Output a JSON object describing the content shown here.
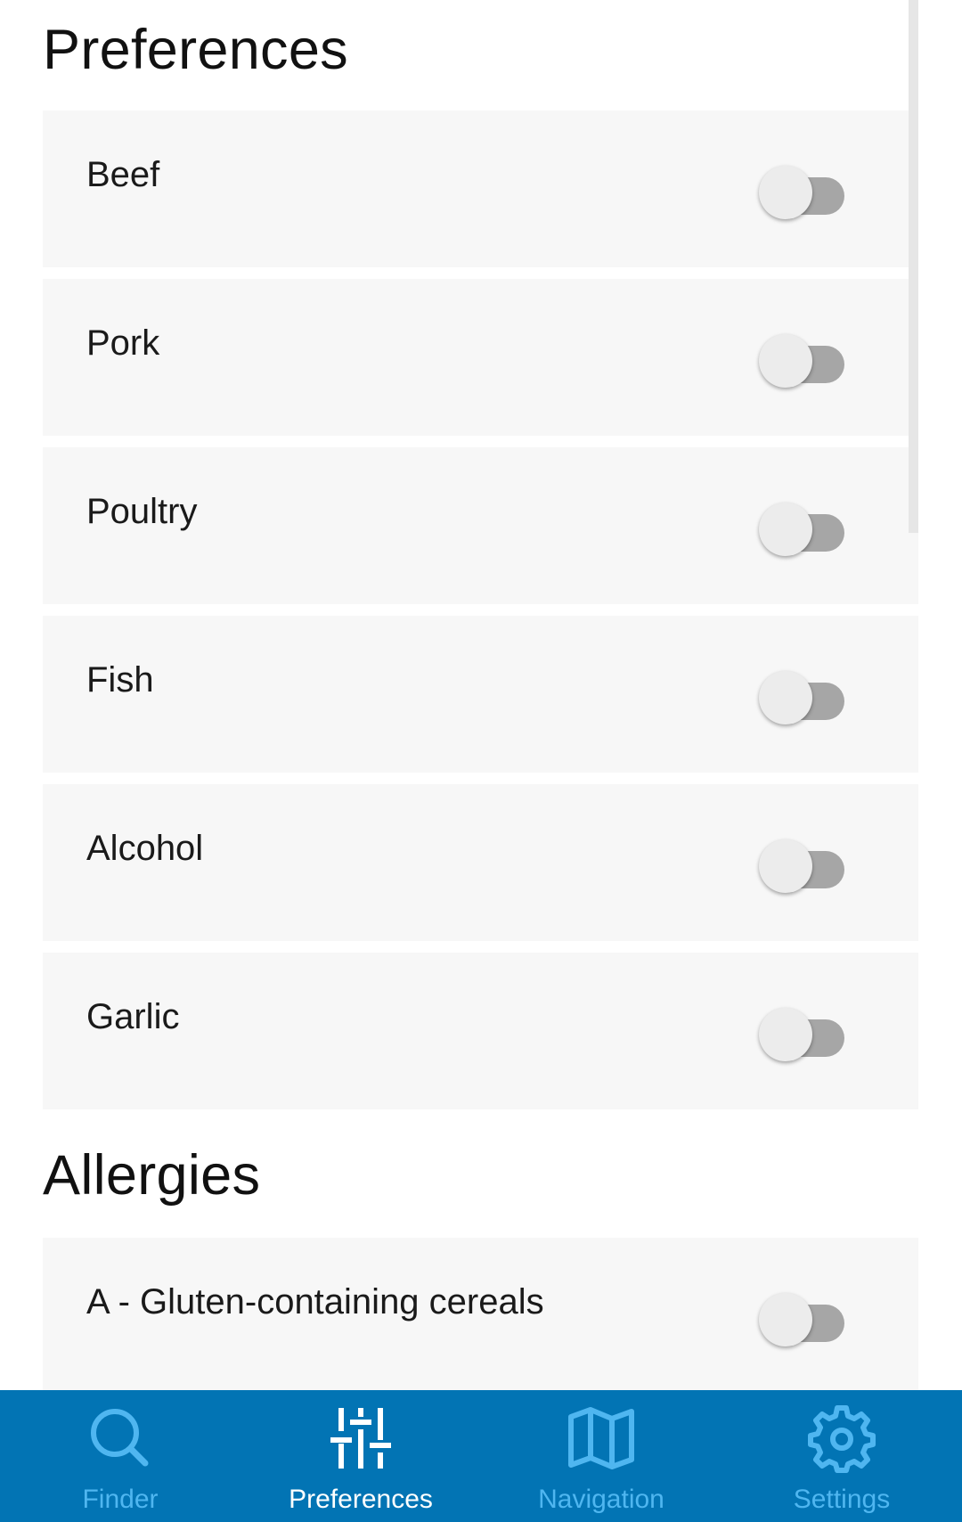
{
  "preferences": {
    "title": "Preferences",
    "items": [
      {
        "label": "Beef",
        "enabled": false
      },
      {
        "label": "Pork",
        "enabled": false
      },
      {
        "label": "Poultry",
        "enabled": false
      },
      {
        "label": "Fish",
        "enabled": false
      },
      {
        "label": "Alcohol",
        "enabled": false
      },
      {
        "label": "Garlic",
        "enabled": false
      }
    ]
  },
  "allergies": {
    "title": "Allergies",
    "items": [
      {
        "label": "A - Gluten-containing cereals",
        "enabled": false
      }
    ]
  },
  "bottom_nav": {
    "active": "Preferences",
    "items": [
      {
        "label": "Finder",
        "icon": "search-icon"
      },
      {
        "label": "Preferences",
        "icon": "sliders-icon"
      },
      {
        "label": "Navigation",
        "icon": "map-icon"
      },
      {
        "label": "Settings",
        "icon": "gear-icon"
      }
    ]
  },
  "colors": {
    "nav_background": "#0274b4",
    "nav_inactive": "#4fb6f0",
    "nav_active": "#ffffff",
    "card_background": "#f7f7f7",
    "toggle_off_track": "#a6a6a6"
  }
}
